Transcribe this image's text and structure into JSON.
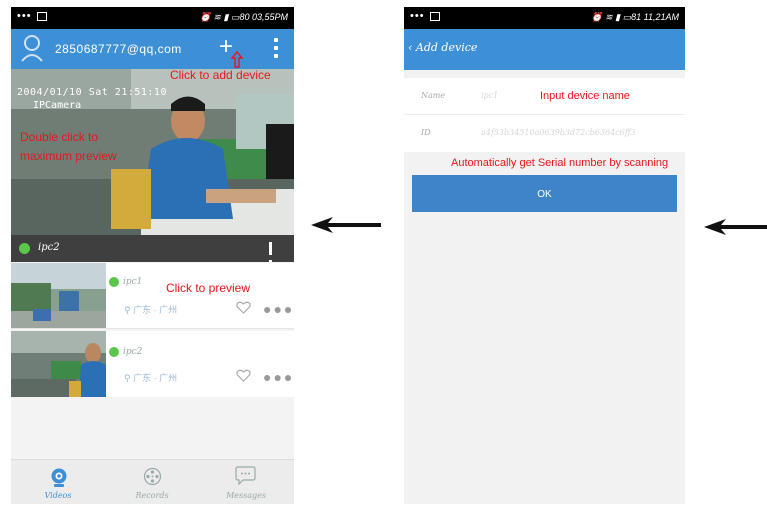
{
  "left_screen": {
    "status": {
      "time": "03,55PM",
      "battery": "80"
    },
    "appbar": {
      "email": "2850687777@qq,com",
      "add_icon": "plus-icon",
      "menu_icon": "more-vertical-icon"
    },
    "video": {
      "overlay_datetime": "2004/01/10  Sat  21:51:10",
      "overlay_camera": "IPCamera"
    },
    "controlbar": {
      "camera_name": "ipc2"
    },
    "list": [
      {
        "name": "ipc1",
        "location": "广东 · 广州"
      },
      {
        "name": "ipc2",
        "location": "广东 · 广州"
      }
    ],
    "bottom_nav": [
      {
        "label": "Videos",
        "icon": "camera-icon",
        "active": true
      },
      {
        "label": "Records",
        "icon": "film-reel-icon",
        "active": false
      },
      {
        "label": "Messages",
        "icon": "chat-bubble-icon",
        "active": false
      }
    ],
    "annotations": {
      "add_device": "Click to add device",
      "double_click": "Double click to maximum preview",
      "preview": "Click to preview"
    }
  },
  "right_screen": {
    "status": {
      "time": "11,21AM",
      "battery": "81"
    },
    "appbar": {
      "title": "Add device"
    },
    "form": {
      "name_label": "Name",
      "name_value": "ipc1",
      "id_label": "ID",
      "id_value": "a4f53b34510a0639b3d72cb6364c6ff3"
    },
    "ok_label": "OK",
    "annotations": {
      "input_name": "Input device name",
      "serial": "Automatically get Serial number by scanning"
    }
  },
  "colors": {
    "appbar": "#3d8fd6",
    "ok_button": "#3f84c9",
    "annotation": "#e8161d",
    "status_green": "#5ac64a"
  }
}
